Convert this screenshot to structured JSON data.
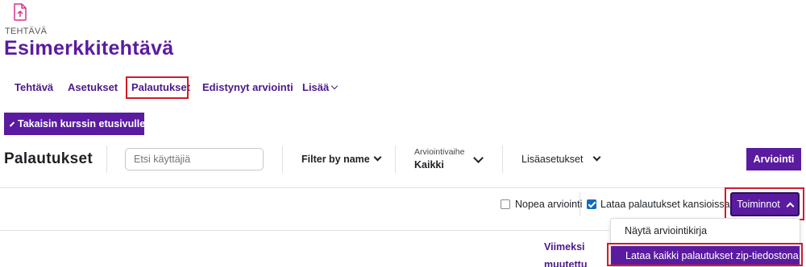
{
  "header": {
    "icon": "file-upload-icon",
    "kicker": "TEHTÄVÄ",
    "title": "Esimerkkitehtävä"
  },
  "nav": {
    "items": [
      {
        "label": "Tehtävä"
      },
      {
        "label": "Asetukset"
      },
      {
        "label": "Palautukset",
        "active": true
      },
      {
        "label": "Edistynyt arviointi"
      },
      {
        "label": "Lisää",
        "has_dropdown": true
      }
    ]
  },
  "back_button": {
    "label": "Takaisin kurssin etusivulle"
  },
  "toolbar": {
    "section_title": "Palautukset",
    "search_placeholder": "Etsi käyttäjiä",
    "filter_by_name": "Filter by name",
    "grading_stage": {
      "label": "Arviointivaihe",
      "value": "Kaikki"
    },
    "advanced": "Lisäasetukset",
    "grade_button": "Arviointi"
  },
  "options": {
    "quick_grading": {
      "label": "Nopea arviointi",
      "checked": false
    },
    "download_in_folders": {
      "label": "Lataa palautukset kansioissa",
      "checked": true
    },
    "actions_button": "Toiminnot"
  },
  "actions_menu": {
    "items": [
      {
        "label": "Näytä arviointikirja"
      },
      {
        "label": "Lataa kaikki palautukset zip-tiedostona",
        "highlighted": true
      }
    ]
  },
  "table": {
    "last_modified_header": [
      "Viimeksi",
      "muutettu"
    ]
  },
  "colors": {
    "brand": "#5a1ba0",
    "link": "#4a1a8a",
    "highlight_outline": "#d11a2a",
    "checkbox": "#0f6cbf"
  }
}
